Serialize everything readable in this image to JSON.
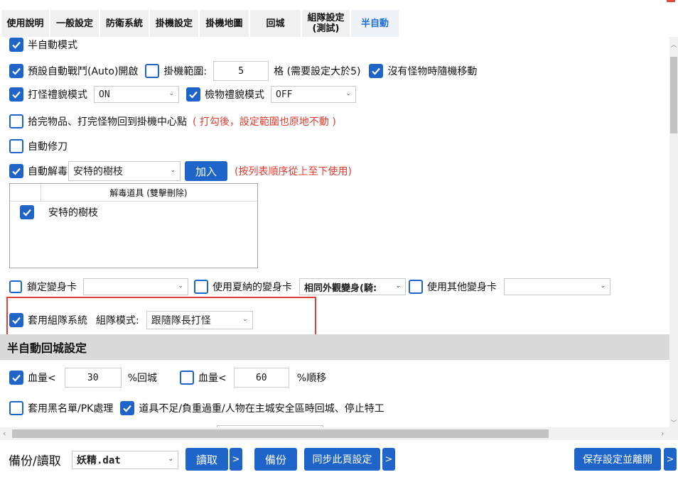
{
  "tabs": [
    {
      "label": "使用說明"
    },
    {
      "label": "一般設定"
    },
    {
      "label": "防衛系統"
    },
    {
      "label": "掛機設定"
    },
    {
      "label": "掛機地圖"
    },
    {
      "label": "回城"
    },
    {
      "label": "組隊設定\n(測試)"
    },
    {
      "label": "半自動",
      "active": true
    }
  ],
  "settings": {
    "semi_auto_mode": {
      "label": "半自動模式",
      "checked": true
    },
    "auto_battle": {
      "label": "預設自動戰鬥(Auto)開啟",
      "checked": true
    },
    "afk_range": {
      "label": "掛機範圍:",
      "checked": false,
      "value": "5",
      "suffix": "格 (需要設定大於5)"
    },
    "random_move": {
      "label": "沒有怪物時隨機移動",
      "checked": true
    },
    "hunt_etiquette": {
      "label": "打怪禮貌模式",
      "checked": true,
      "value": "ON"
    },
    "loot_etiquette": {
      "label": "檢物禮貌模式",
      "checked": true,
      "value": "OFF"
    },
    "return_center": {
      "label": "拾完物品、打完怪物回到掛機中心點",
      "checked": false,
      "note": "( 打勾後，設定範圍也原地不動 )"
    },
    "auto_repair": {
      "label": "自動修刀",
      "checked": false
    },
    "auto_detox": {
      "label": "自動解毒",
      "checked": true,
      "value": "安特的樹枝",
      "add_label": "加入",
      "note": "(按列表順序從上至下使用)"
    },
    "detox_list": {
      "header": "解毒道具 (雙擊刪除)",
      "items": [
        {
          "label": "安特的樹枝",
          "checked": true
        }
      ]
    },
    "lock_poly_card": {
      "label": "鎖定變身卡",
      "checked": false,
      "value": ""
    },
    "summer_poly_card": {
      "label": "使用夏納的變身卡",
      "checked": false,
      "value": "相同外觀變身(騎:"
    },
    "other_poly_card": {
      "label": "使用其他變身卡",
      "checked": false,
      "value": ""
    },
    "party_system": {
      "label": "套用組隊系統",
      "checked": true,
      "mode_label": "組隊模式:",
      "mode_value": "跟隨隊長打怪"
    }
  },
  "return_section": {
    "title": "半自動回城設定",
    "hp_return": {
      "label": "血量<",
      "checked": true,
      "value": "30",
      "suffix": "%回城"
    },
    "hp_move": {
      "label": "血量<",
      "checked": false,
      "value": "60",
      "suffix": "%順移"
    },
    "blacklist": {
      "label": "套用黑名單/PK處理",
      "checked": false
    },
    "item_shortage": {
      "label": "道具不足/負重過重/人物在主城安全區時回城、停止特工",
      "checked": true
    }
  },
  "bottom": {
    "backup_label": "備份/讀取",
    "file_value": "妖精.dat",
    "read_label": "讀取",
    "more_label": ">",
    "backup_btn": "備份",
    "sync_label": "同步此頁設定",
    "save_label": "保存設定並離開"
  },
  "colors": {
    "accent": "#1f64c8",
    "warning": "#e23b2e",
    "section_bg": "#d9d9d9"
  }
}
